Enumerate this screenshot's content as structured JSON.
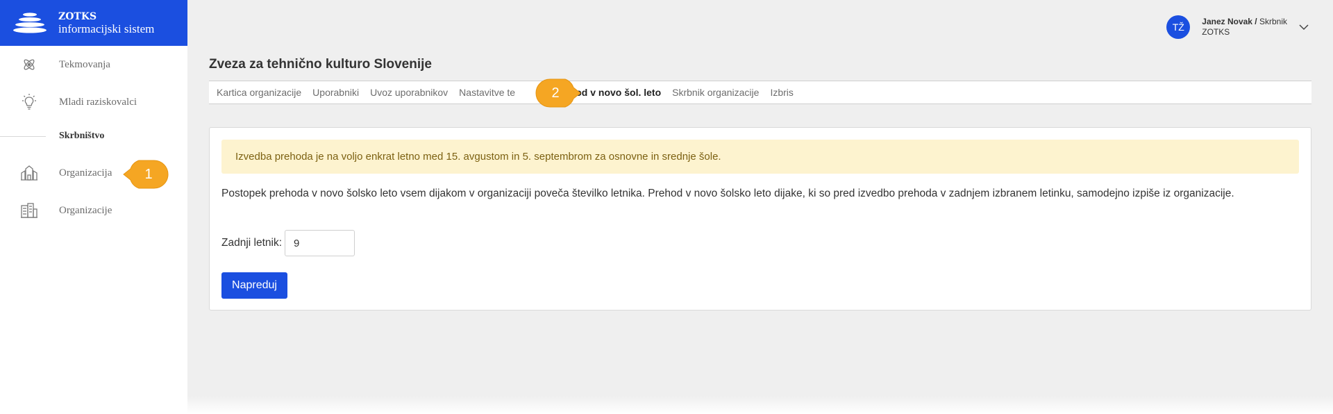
{
  "brand": {
    "name": "ZOTKS",
    "subtitle": "informacijski sistem",
    "color": "#1b4fe0"
  },
  "sidebar": {
    "items": [
      {
        "label": "Tekmovanja",
        "icon": "atom-icon"
      },
      {
        "label": "Mladi raziskovalci",
        "icon": "lightbulb-icon"
      }
    ],
    "section_title": "Skrbništvo",
    "section_items": [
      {
        "label": "Organizacija",
        "icon": "building-icon"
      },
      {
        "label": "Organizacije",
        "icon": "buildings-icon"
      }
    ]
  },
  "user": {
    "initials": "TŽ",
    "name": "Janez Novak /",
    "role": "Skrbnik",
    "org": "ZOTKS"
  },
  "page": {
    "title": "Zveza za tehnično kulturo Slovenije"
  },
  "tabs": [
    {
      "label": "Kartica organizacije"
    },
    {
      "label": "Uporabniki"
    },
    {
      "label": "Uvoz uporabnikov"
    },
    {
      "label": "Nastavitve te"
    },
    {
      "label": "Prehod v novo šol. leto",
      "active": true
    },
    {
      "label": "Skrbnik organizacije"
    },
    {
      "label": "Izbris"
    }
  ],
  "content": {
    "alert": "Izvedba prehoda je na voljo enkrat letno med 15. avgustom in 5. septembrom za osnovne in srednje šole.",
    "description": "Postopek prehoda v novo šolsko leto vsem dijakom v organizaciji poveča številko letnika. Prehod v novo šolsko leto dijake, ki so pred izvedbo prehoda v zadnjem izbranem letinku, samodejno izpiše iz organizacije.",
    "field_label": "Zadnji letnik:",
    "field_value": "9",
    "submit_label": "Napreduj"
  },
  "callouts": [
    {
      "number": "1",
      "color": "#f5a623"
    },
    {
      "number": "2",
      "color": "#f5a623"
    }
  ]
}
